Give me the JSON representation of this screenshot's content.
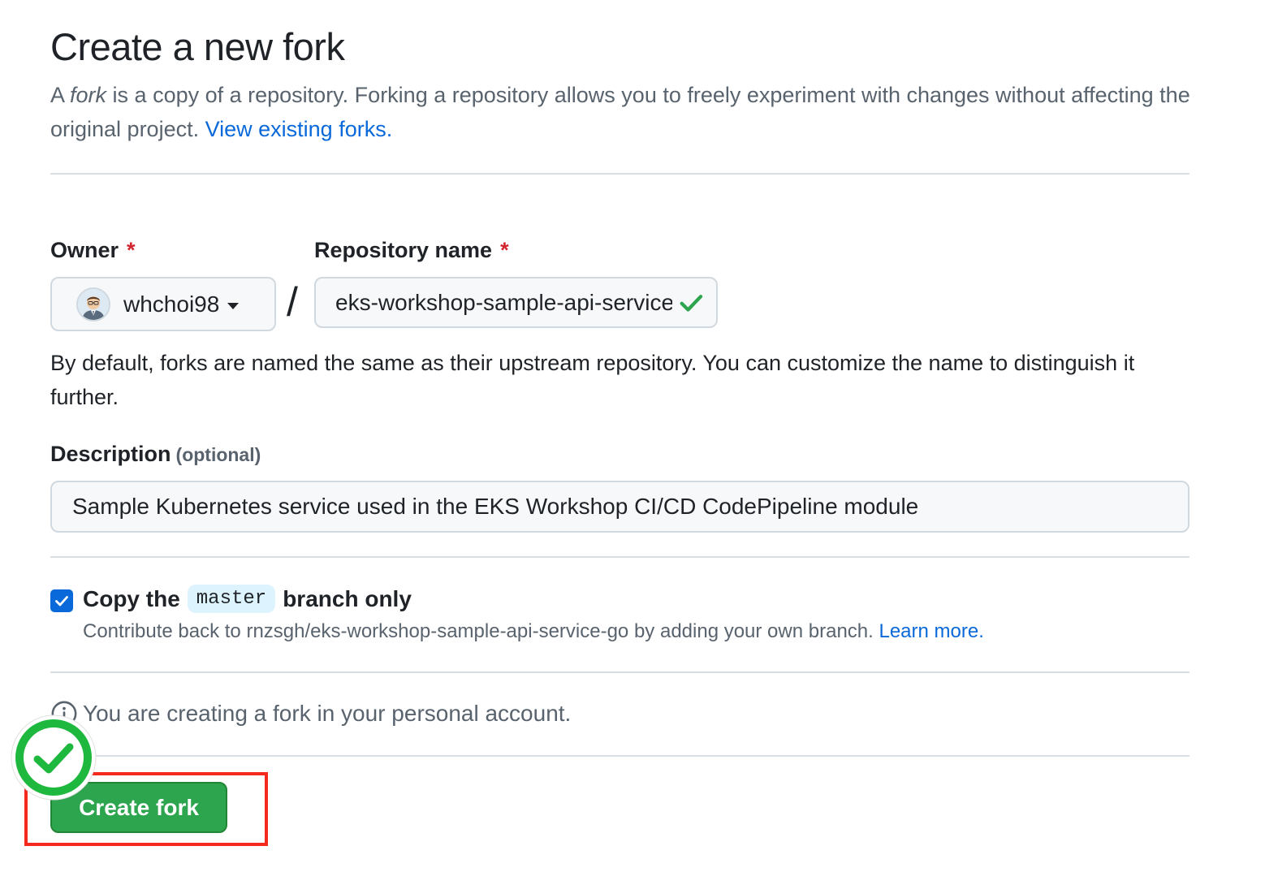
{
  "header": {
    "title": "Create a new fork",
    "intro_prefix": "A ",
    "intro_em": "fork",
    "intro_rest": " is a copy of a repository. Forking a repository allows you to freely experiment with changes without affecting the original project. ",
    "view_forks_link": "View existing forks."
  },
  "owner": {
    "label": "Owner",
    "required_mark": "*",
    "selected": "whchoi98"
  },
  "repository": {
    "label": "Repository name",
    "required_mark": "*",
    "separator": "/",
    "value": "eks-workshop-sample-api-service-go",
    "status": "valid"
  },
  "naming_help": "By default, forks are named the same as their upstream repository. You can customize the name to distinguish it further.",
  "description": {
    "label": "Description",
    "optional": "(optional)",
    "value": "Sample Kubernetes service used in the EKS Workshop CI/CD CodePipeline module"
  },
  "copy_branch": {
    "checked": true,
    "label_before": "Copy the",
    "branch": "master",
    "label_after": "branch only",
    "help": "Contribute back to rnzsgh/eks-workshop-sample-api-service-go by adding your own branch. ",
    "learn_more": "Learn more."
  },
  "info": {
    "icon": "info-icon",
    "text": "You are creating a fork in your personal account."
  },
  "actions": {
    "create_label": "Create fork"
  },
  "colors": {
    "primary_button": "#2da44e",
    "link": "#0969da",
    "required": "#d1242f",
    "highlight_box": "#f5291d",
    "success_badge": "#1fb83f"
  }
}
